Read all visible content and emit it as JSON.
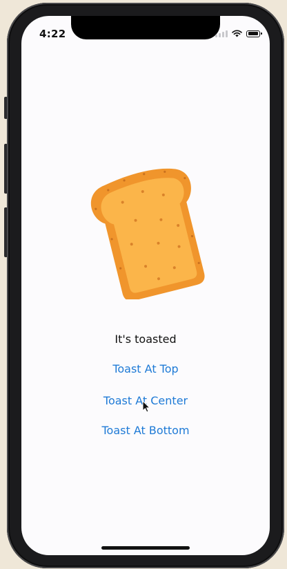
{
  "status_bar": {
    "time": "4:22",
    "icons": [
      "cellular-signal-icon",
      "wifi-icon",
      "battery-icon"
    ]
  },
  "content": {
    "image": "toast-bread-slice",
    "label": "It's toasted",
    "buttons": {
      "top": "Toast At Top",
      "center": "Toast At Center",
      "bottom": "Toast At Bottom"
    }
  },
  "colors": {
    "accent": "#1e7ad6",
    "screen_background": "#fcfbfd",
    "toast_crust": "#f0952c",
    "toast_crumb": "#fbb54a"
  }
}
